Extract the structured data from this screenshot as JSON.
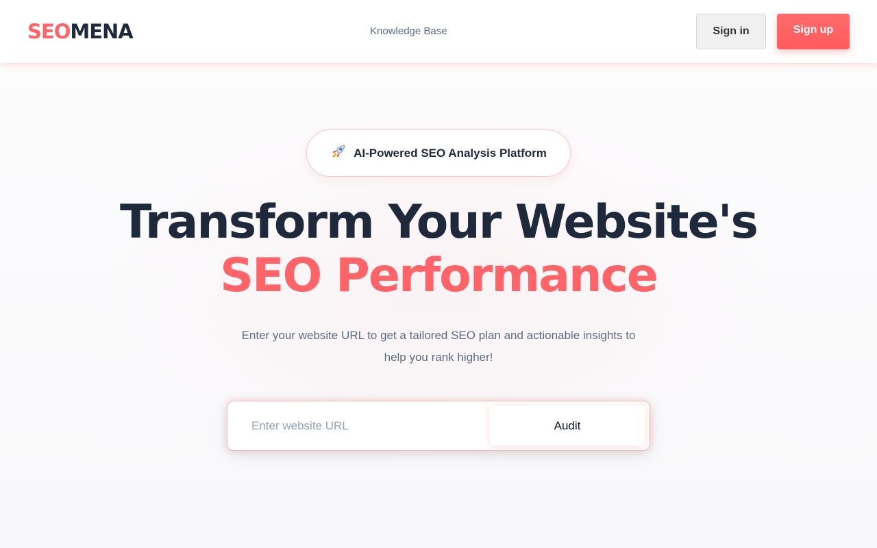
{
  "header": {
    "logo": {
      "part1": "SEO",
      "part2": "MENA"
    },
    "nav": {
      "knowledge_base": "Knowledge Base"
    },
    "signin_label": "Sign in",
    "signup_label": "Sign up"
  },
  "hero": {
    "badge": {
      "icon": "rocket-icon",
      "text": "AI-Powered SEO Analysis Platform"
    },
    "headline_line1": "Transform Your Website's",
    "headline_line2": "SEO Performance",
    "subtitle": "Enter your website URL to get a tailored SEO plan and actionable insights to help you rank higher!"
  },
  "audit_form": {
    "placeholder": "Enter website URL",
    "value": "",
    "button_label": "Audit"
  },
  "colors": {
    "brand": "#ff6568",
    "dark_text": "#1e293b",
    "muted_text": "#5b6b82",
    "placeholder": "#94a3b8"
  }
}
